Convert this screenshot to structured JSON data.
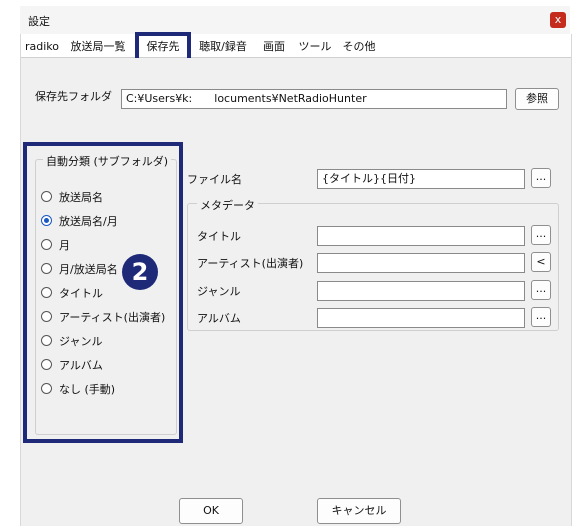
{
  "window": {
    "title": "設定",
    "close_label": "x"
  },
  "tabs": [
    {
      "label": "radiko"
    },
    {
      "label": "放送局一覧"
    },
    {
      "label": "保存先"
    },
    {
      "label": "聴取/録音"
    },
    {
      "label": "画面"
    },
    {
      "label": "ツール"
    },
    {
      "label": "その他"
    }
  ],
  "save_folder": {
    "label": "保存先フォルダ",
    "value_part1": "C:¥Users¥k:",
    "value_part2": "locuments¥NetRadioHunter",
    "browse_label": "参照"
  },
  "auto_classify": {
    "legend": "自動分類 (サブフォルダ)",
    "options": [
      {
        "label": "放送局名",
        "selected": false
      },
      {
        "label": "放送局名/月",
        "selected": true
      },
      {
        "label": "月",
        "selected": false
      },
      {
        "label": "月/放送局名",
        "selected": false
      },
      {
        "label": "タイトル",
        "selected": false
      },
      {
        "label": "アーティスト(出演者)",
        "selected": false
      },
      {
        "label": "ジャンル",
        "selected": false
      },
      {
        "label": "アルバム",
        "selected": false
      },
      {
        "label": "なし (手動)",
        "selected": false
      }
    ],
    "badge": "2"
  },
  "file_name": {
    "label": "ファイル名",
    "value": "{タイトル}{日付}",
    "button_label": "..."
  },
  "metadata": {
    "legend": "メタデータ",
    "fields": [
      {
        "label": "タイトル",
        "value": "",
        "button_label": "..."
      },
      {
        "label": "アーティスト(出演者)",
        "value": "",
        "button_label": "<"
      },
      {
        "label": "ジャンル",
        "value": "",
        "button_label": "..."
      },
      {
        "label": "アルバム",
        "value": "",
        "button_label": "..."
      }
    ]
  },
  "footer": {
    "ok_label": "OK",
    "cancel_label": "キャンセル"
  },
  "colors": {
    "highlight": "#1e2a78",
    "close": "#c42b1c",
    "radio_selected": "#1a56c4"
  }
}
